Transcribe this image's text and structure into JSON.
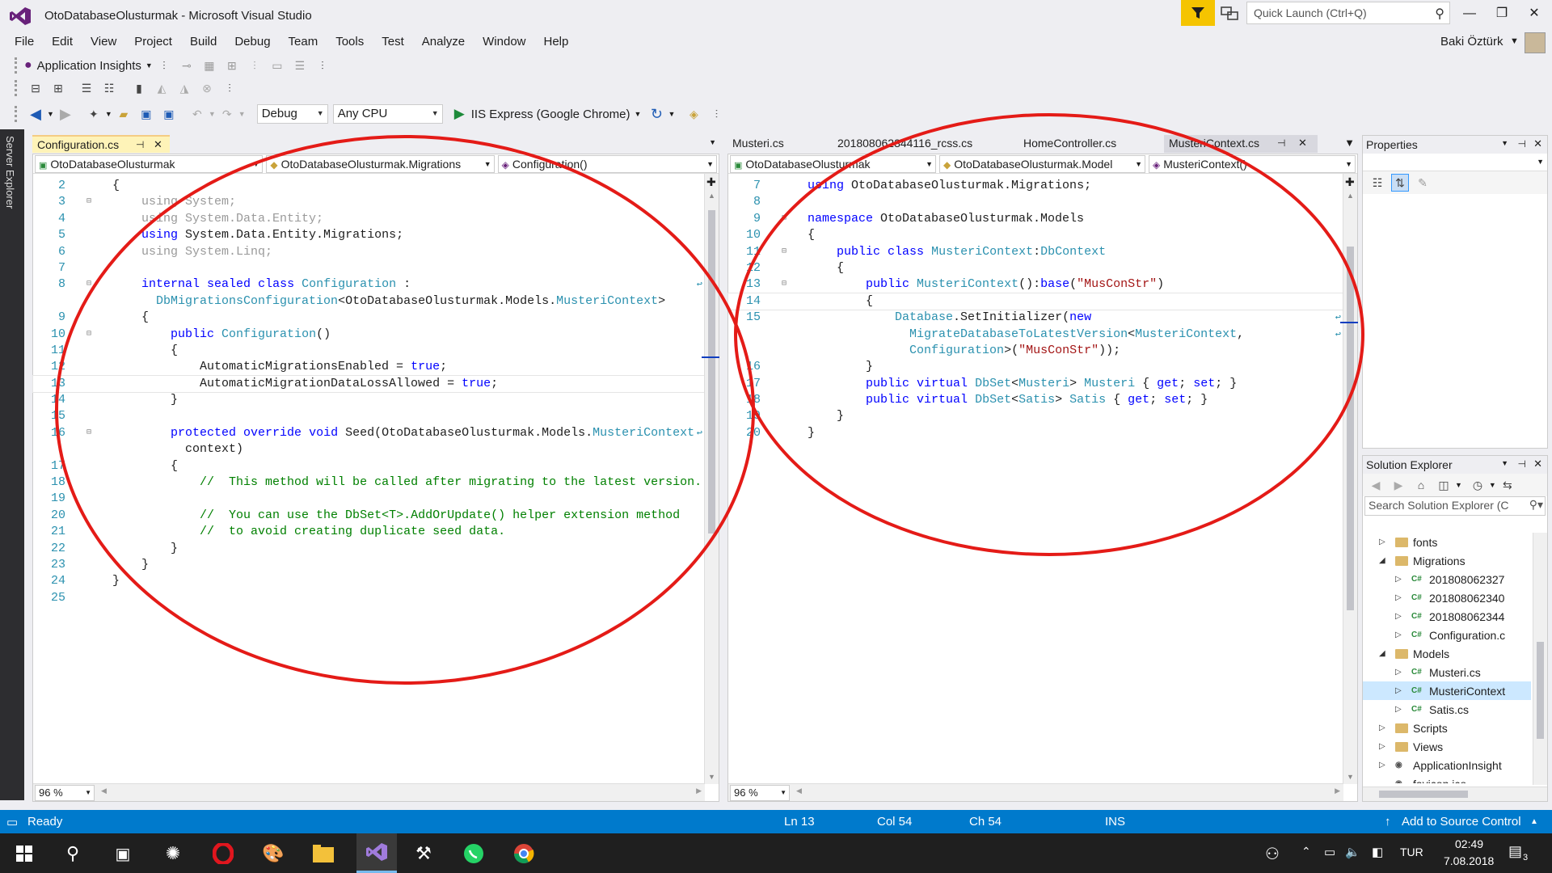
{
  "window": {
    "title": "OtoDatabaseOlusturmak - Microsoft Visual Studio",
    "quick_launch_placeholder": "Quick Launch (Ctrl+Q)",
    "user_name": "Baki Öztürk"
  },
  "menu": [
    "File",
    "Edit",
    "View",
    "Project",
    "Build",
    "Debug",
    "Team",
    "Tools",
    "Test",
    "Analyze",
    "Window",
    "Help"
  ],
  "toolbar": {
    "app_insights": "Application Insights",
    "config": "Debug",
    "platform": "Any CPU",
    "run_target": "IIS Express (Google Chrome)"
  },
  "server_explorer_label": "Server Explorer",
  "left_editor": {
    "tab": "Configuration.cs",
    "nav_project": "OtoDatabaseOlusturmak",
    "nav_class": "OtoDatabaseOlusturmak.Migrations",
    "nav_member": "Configuration()",
    "zoom": "96 %",
    "lines": [
      {
        "n": "2",
        "t": "{"
      },
      {
        "n": "3",
        "t": "    using System;"
      },
      {
        "n": "4",
        "t": "    using System.Data.Entity;"
      },
      {
        "n": "5",
        "t": "    using System.Data.Entity.Migrations;"
      },
      {
        "n": "6",
        "t": "    using System.Linq;"
      },
      {
        "n": "7",
        "t": ""
      },
      {
        "n": "8",
        "t": "    internal sealed class Configuration :"
      },
      {
        "n": "",
        "t": "      DbMigrationsConfiguration<OtoDatabaseOlusturmak.Models.MusteriContext>"
      },
      {
        "n": "9",
        "t": "    {"
      },
      {
        "n": "10",
        "t": "        public Configuration()"
      },
      {
        "n": "11",
        "t": "        {"
      },
      {
        "n": "12",
        "t": "            AutomaticMigrationsEnabled = true;"
      },
      {
        "n": "13",
        "t": "            AutomaticMigrationDataLossAllowed = true;"
      },
      {
        "n": "14",
        "t": "        }"
      },
      {
        "n": "15",
        "t": ""
      },
      {
        "n": "16",
        "t": "        protected override void Seed(OtoDatabaseOlusturmak.Models.MusteriContext"
      },
      {
        "n": "",
        "t": "          context)"
      },
      {
        "n": "17",
        "t": "        {"
      },
      {
        "n": "18",
        "t": "            //  This method will be called after migrating to the latest version."
      },
      {
        "n": "19",
        "t": ""
      },
      {
        "n": "20",
        "t": "            //  You can use the DbSet<T>.AddOrUpdate() helper extension method"
      },
      {
        "n": "21",
        "t": "            //  to avoid creating duplicate seed data."
      },
      {
        "n": "22",
        "t": "        }"
      },
      {
        "n": "23",
        "t": "    }"
      },
      {
        "n": "24",
        "t": "}"
      },
      {
        "n": "25",
        "t": ""
      }
    ]
  },
  "right_editor": {
    "tabs": [
      "Musteri.cs",
      "201808062344116_rcss.cs",
      "HomeController.cs",
      "MusteriContext.cs"
    ],
    "nav_project": "OtoDatabaseOlusturmak",
    "nav_class": "OtoDatabaseOlusturmak.Model",
    "nav_member": "MusteriContext()",
    "zoom": "96 %",
    "lines": [
      {
        "n": "7",
        "t": "using OtoDatabaseOlusturmak.Migrations;"
      },
      {
        "n": "8",
        "t": ""
      },
      {
        "n": "9",
        "t": "namespace OtoDatabaseOlusturmak.Models"
      },
      {
        "n": "10",
        "t": "{"
      },
      {
        "n": "11",
        "t": "    public class MusteriContext:DbContext"
      },
      {
        "n": "12",
        "t": "    {"
      },
      {
        "n": "13",
        "t": "        public MusteriContext():base(\"MusConStr\")"
      },
      {
        "n": "14",
        "t": "        {"
      },
      {
        "n": "15",
        "t": "            Database.SetInitializer(new"
      },
      {
        "n": "",
        "t": "              MigrateDatabaseToLatestVersion<MusteriContext,"
      },
      {
        "n": "",
        "t": "              Configuration>(\"MusConStr\"));"
      },
      {
        "n": "16",
        "t": "        }"
      },
      {
        "n": "17",
        "t": "        public virtual DbSet<Musteri> Musteri { get; set; }"
      },
      {
        "n": "18",
        "t": "        public virtual DbSet<Satis> Satis { get; set; }"
      },
      {
        "n": "19",
        "t": "    }"
      },
      {
        "n": "20",
        "t": "}"
      }
    ]
  },
  "properties": {
    "title": "Properties"
  },
  "solution_explorer": {
    "title": "Solution Explorer",
    "search_placeholder": "Search Solution Explorer (C",
    "items": [
      {
        "label": "fonts",
        "kind": "folder",
        "level": 0,
        "arrow": "▷"
      },
      {
        "label": "Migrations",
        "kind": "folder",
        "level": 0,
        "arrow": "◢"
      },
      {
        "label": "201808062327",
        "kind": "cs",
        "level": 1,
        "arrow": "▷"
      },
      {
        "label": "201808062340",
        "kind": "cs",
        "level": 1,
        "arrow": "▷"
      },
      {
        "label": "201808062344",
        "kind": "cs",
        "level": 1,
        "arrow": "▷"
      },
      {
        "label": "Configuration.c",
        "kind": "cs",
        "level": 1,
        "arrow": "▷"
      },
      {
        "label": "Models",
        "kind": "folder",
        "level": 0,
        "arrow": "◢"
      },
      {
        "label": "Musteri.cs",
        "kind": "cs",
        "level": 1,
        "arrow": "▷"
      },
      {
        "label": "MusteriContext",
        "kind": "cs",
        "level": 1,
        "arrow": "▷",
        "selected": true
      },
      {
        "label": "Satis.cs",
        "kind": "cs",
        "level": 1,
        "arrow": "▷"
      },
      {
        "label": "Scripts",
        "kind": "folder",
        "level": 0,
        "arrow": "▷"
      },
      {
        "label": "Views",
        "kind": "folder",
        "level": 0,
        "arrow": "▷"
      },
      {
        "label": "ApplicationInsight",
        "kind": "file",
        "level": 0,
        "arrow": "▷"
      },
      {
        "label": "favicon.ico",
        "kind": "file",
        "level": 0,
        "arrow": ""
      }
    ]
  },
  "status": {
    "ready": "Ready",
    "ln": "Ln 13",
    "col": "Col 54",
    "ch": "Ch 54",
    "mode": "INS",
    "source_control": "Add to Source Control"
  },
  "taskbar": {
    "language": "TUR",
    "time": "02:49",
    "date": "7.08.2018",
    "notifications": "3"
  }
}
